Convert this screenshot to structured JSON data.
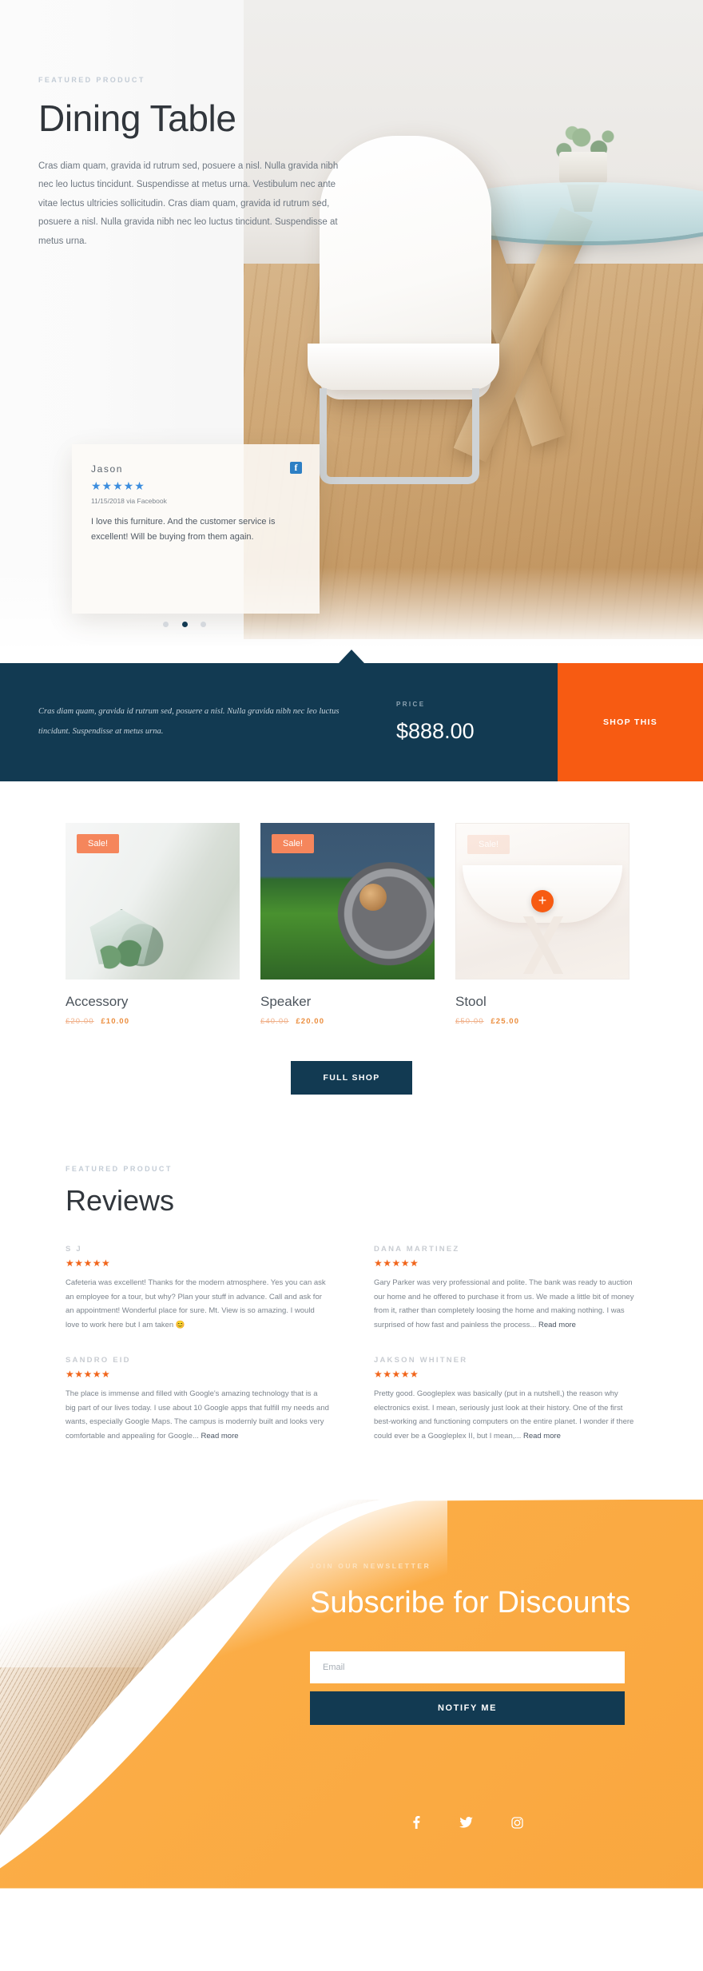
{
  "hero": {
    "eyebrow": "FEATURED PRODUCT",
    "title": "Dining Table",
    "description": "Cras diam quam, gravida id rutrum sed, posuere a nisl. Nulla gravida nibh nec leo luctus tincidunt. Suspendisse at metus urna. Vestibulum nec ante vitae lectus ultricies sollicitudin. Cras diam quam, gravida id rutrum sed, posuere a nisl. Nulla gravida nibh nec leo luctus tincidunt. Suspendisse at metus urna."
  },
  "testimonial": {
    "name": "Jason",
    "stars": "★★★★★",
    "date": "11/15/2018 via Facebook",
    "body": "I love this furniture. And the customer service is excellent! Will be buying from them again.",
    "source_icon": "facebook-icon",
    "source_letter": "f",
    "slide_count": 3,
    "active_slide": 2
  },
  "price_bar": {
    "description": "Cras diam quam, gravida id rutrum sed, posuere a nisl. Nulla gravida nibh nec leo luctus tincidunt. Suspendisse at metus urna.",
    "price_label": "PRICE",
    "price": "$888.00",
    "cta_label": "SHOP THIS",
    "bg_color": "#123a52",
    "cta_color": "#f75b12"
  },
  "products": {
    "items": [
      {
        "name": "Accessory",
        "badge": "Sale!",
        "old_price": "£20.00",
        "new_price": "£10.00"
      },
      {
        "name": "Speaker",
        "badge": "Sale!",
        "old_price": "£40.00",
        "new_price": "£20.00"
      },
      {
        "name": "Stool",
        "badge": "Sale!",
        "old_price": "£50.00",
        "new_price": "£25.00"
      }
    ],
    "full_shop_label": "FULL SHOP",
    "add_icon": "plus-icon"
  },
  "reviews": {
    "eyebrow": "FEATURED PRODUCT",
    "title": "Reviews",
    "read_more_label": "Read more",
    "star_color": "#f1651b",
    "items": [
      {
        "name": "S J",
        "stars": "★★★★★",
        "text": "Cafeteria was excellent! Thanks for the modern atmosphere. Yes you can ask an employee for a tour, but why? Plan your stuff in advance. Call and ask for an appointment! Wonderful place for sure. Mt. View is so amazing. I would love to work here but I am taken 😊",
        "has_read_more": false
      },
      {
        "name": "DANA MARTINEZ",
        "stars": "★★★★★",
        "text": "Gary Parker was very professional and polite. The bank was ready to auction our home and he offered to purchase it from us. We made a little bit of money from it, rather than completely loosing the home and making nothing. I was surprised of how fast and painless the process... ",
        "has_read_more": true
      },
      {
        "name": "SANDRO EID",
        "stars": "★★★★★",
        "text": "The place is immense and filled with Google's amazing technology that is a big part of our lives today. I use about 10 Google apps that fulfill my needs and wants, especially Google Maps. The campus is modernly built and looks very comfortable and appealing for Google... ",
        "has_read_more": true
      },
      {
        "name": "JAKSON WHITNER",
        "stars": "★★★★★",
        "text": "Pretty good. Googleplex was basically (put in a nutshell,) the reason why electronics exist. I mean, seriously just look at their history. One of the first best-working and functioning computers on the entire planet. I wonder if there could ever be a Googleplex II, but I mean,... ",
        "has_read_more": true
      }
    ]
  },
  "newsletter": {
    "eyebrow": "JOIN OUR NEWSLETTER",
    "title": "Subscribe for Discounts",
    "email_placeholder": "Email",
    "email_value": "",
    "button_label": "NOTIFY ME",
    "bg_color": "#fbac45",
    "button_color": "#123a52",
    "social": [
      {
        "icon": "facebook-icon",
        "label": "Facebook"
      },
      {
        "icon": "twitter-icon",
        "label": "Twitter"
      },
      {
        "icon": "instagram-icon",
        "label": "Instagram"
      }
    ]
  }
}
